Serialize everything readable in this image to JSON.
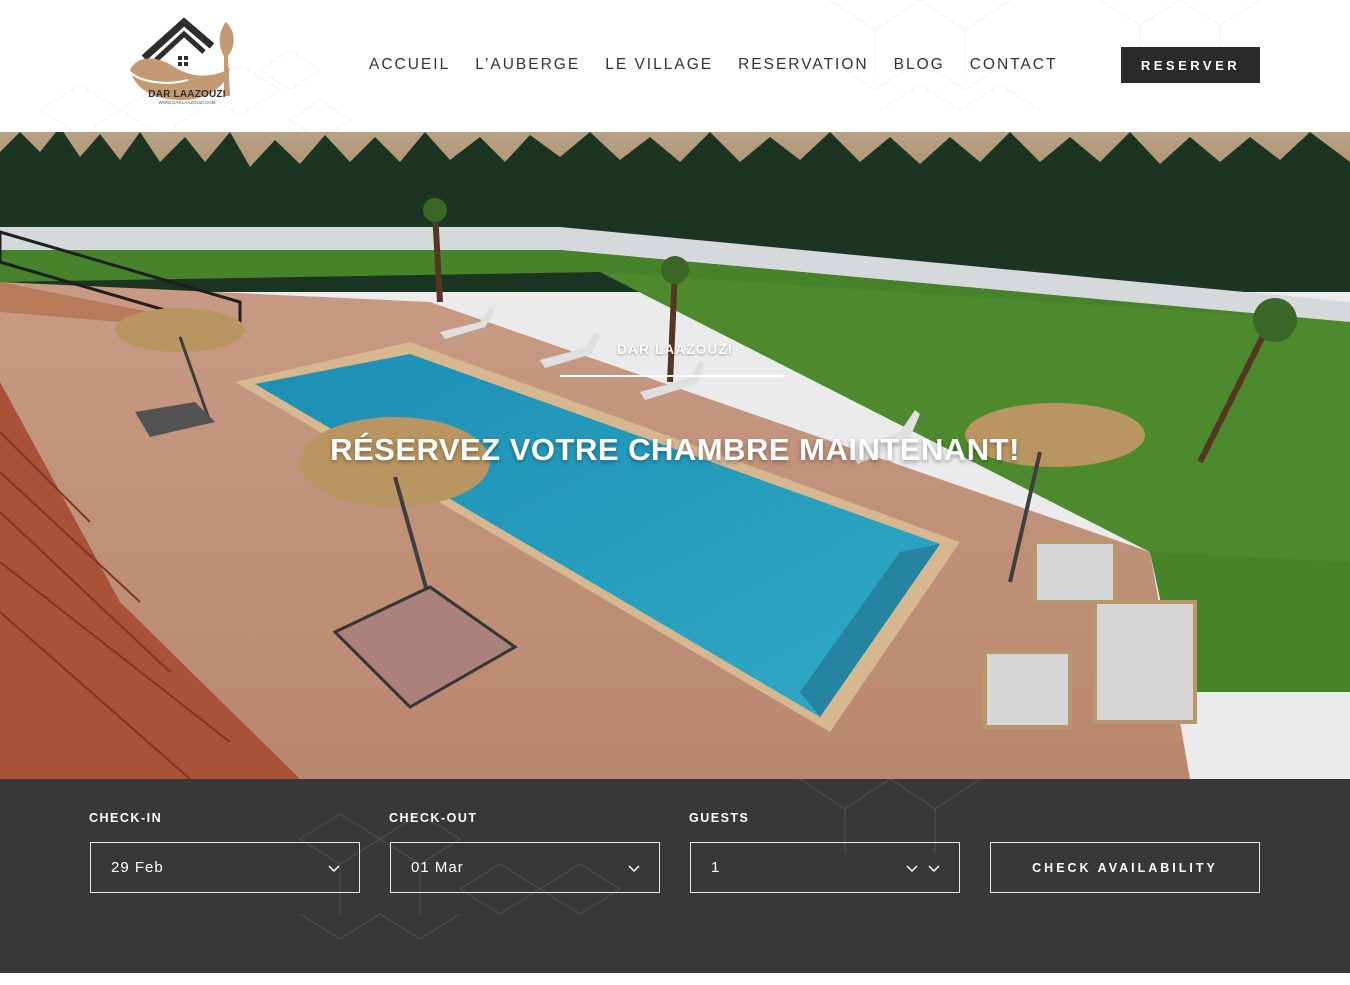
{
  "brand": {
    "name": "DAR LAAZOUZI",
    "website": "WWW.DARLAAZOUZI.COM"
  },
  "nav": {
    "items": [
      "ACCUEIL",
      "L’AUBERGE",
      "LE VILLAGE",
      "RESERVATION",
      "BLOG",
      "CONTACT"
    ],
    "cta_label": "RESERVER"
  },
  "hero": {
    "kicker": "DAR LAAZOUZI",
    "title": "RÉSERVEZ VOTRE CHAMBRE MAINTENANT!",
    "image_description": "pool"
  },
  "booking": {
    "checkin_label": "CHECK-IN",
    "checkin_value": "29 Feb",
    "checkout_label": "CHECK-OUT",
    "checkout_value": "01 Mar",
    "guests_label": "GUESTS",
    "guests_value": "1",
    "submit_label": "CHECK AVAILABILITY"
  },
  "colors": {
    "dark": "#2a2a2a",
    "booking_bg": "#383838",
    "logo_brown": "#c49a74",
    "pool": "#2aa6c9",
    "lawn": "#4d8f2e"
  }
}
